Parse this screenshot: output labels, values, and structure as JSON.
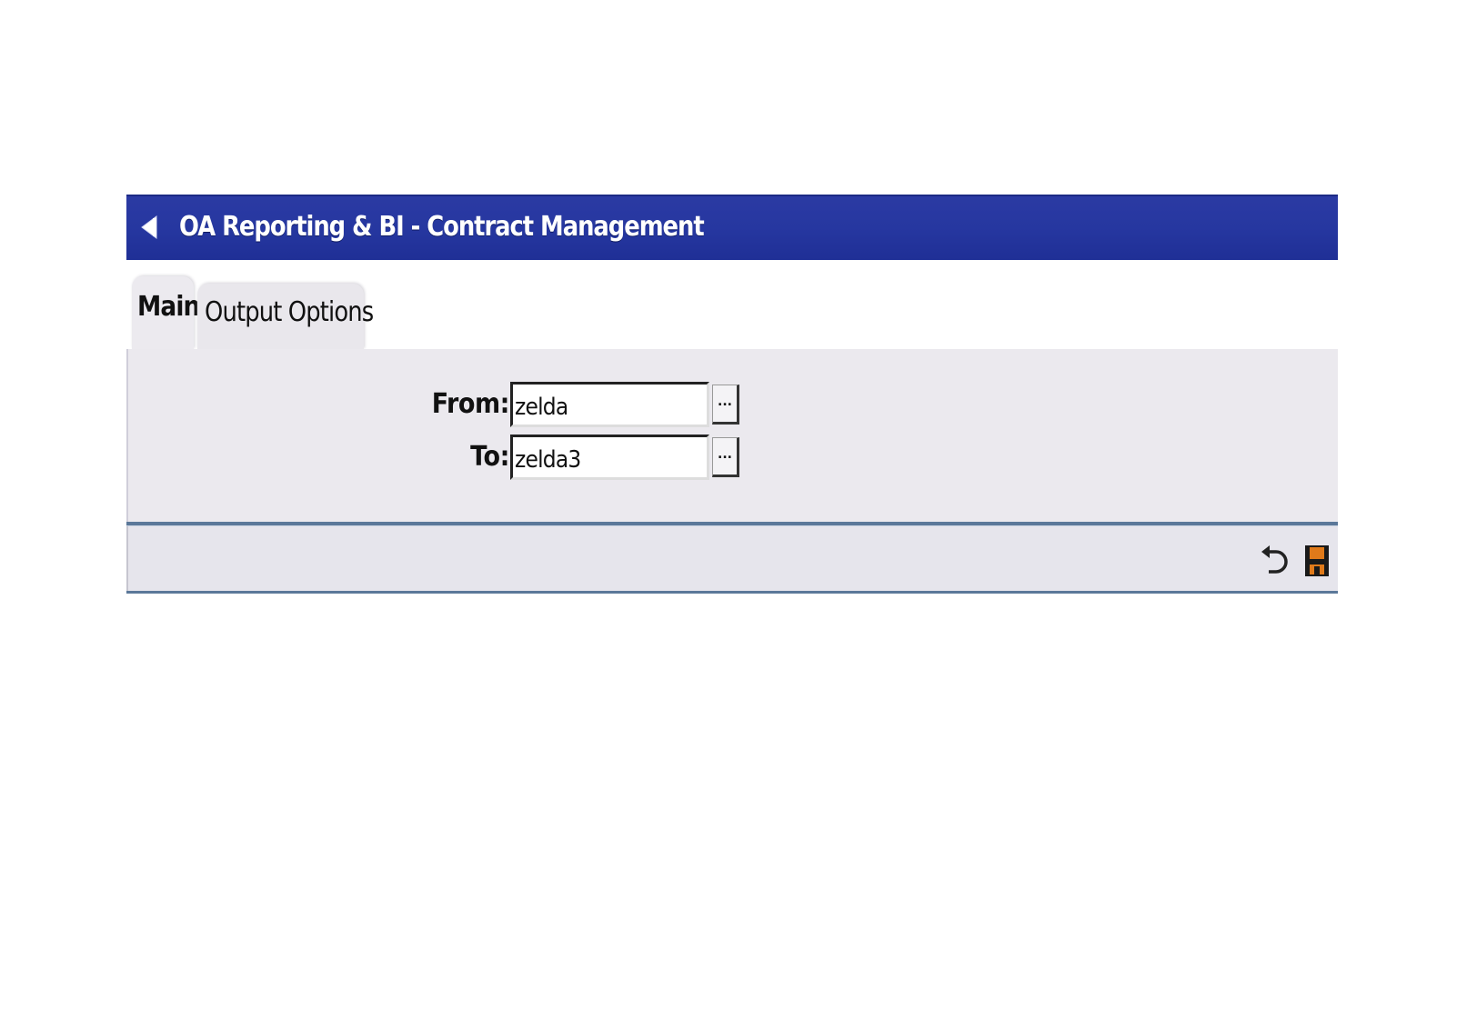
{
  "window": {
    "title": "OA Reporting & BI - Contract Management",
    "back_icon": "back-arrow-icon"
  },
  "tabs": [
    {
      "label": "Main",
      "active": true
    },
    {
      "label": "Output Options",
      "active": false
    }
  ],
  "form": {
    "from_label": "From:",
    "from_value": "zelda",
    "to_label": "To:",
    "to_value": "zelda3",
    "browse_label": "..."
  },
  "footer": {
    "actions": [
      {
        "name": "undo",
        "icon": "undo-icon"
      },
      {
        "name": "save",
        "icon": "save-floppy-icon"
      }
    ]
  },
  "colors": {
    "titlebar": "#2637a0",
    "panel": "#ebe9ee",
    "divider": "#5b7899",
    "save_icon_accent": "#e07a1a"
  }
}
